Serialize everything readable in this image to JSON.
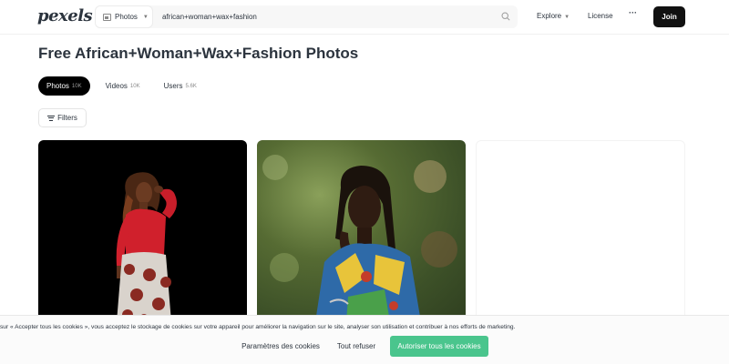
{
  "header": {
    "logo": "pexels",
    "search_type": "Photos",
    "search_value": "african+woman+wax+fashion",
    "nav_explore": "Explore",
    "nav_license": "License",
    "nav_more": "···",
    "join_label": "Join"
  },
  "page_title": "Free African+Woman+Wax+Fashion Photos",
  "tabs": [
    {
      "label": "Photos",
      "count": "10K",
      "active": true
    },
    {
      "label": "Videos",
      "count": "10K",
      "active": false
    },
    {
      "label": "Users",
      "count": "5.6K",
      "active": false
    }
  ],
  "filters_label": "Filters",
  "cookie": {
    "text": "sur « Accepter tous les cookies », vous acceptez le stockage de cookies sur votre appareil pour améliorer la navigation sur le site, analyser son utilisation et contribuer à nos efforts de marketing.",
    "params_label": "Paramètres des cookies",
    "refuse_label": "Tout refuser",
    "accept_label": "Autoriser tous les cookies"
  },
  "colors": {
    "accent_green": "#4ac58d",
    "dark": "#000000",
    "text": "#2c343e"
  }
}
